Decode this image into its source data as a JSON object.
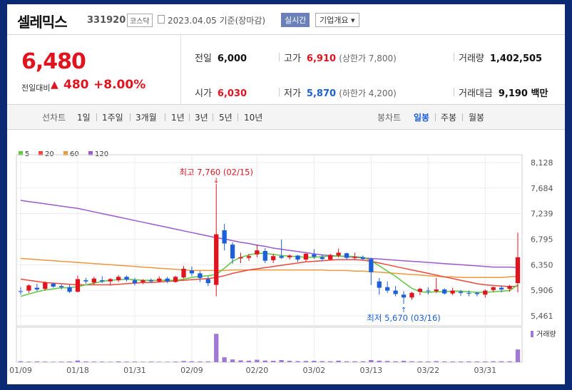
{
  "header": {
    "name": "셀레믹스",
    "code": "331920",
    "market": "코스닥",
    "date": "2023.04.05 기준(장마감)",
    "realtime_label": "실시간",
    "overview_label": "기업개요 ▾"
  },
  "price": {
    "current": "6,480",
    "change_label": "전일대비",
    "change_arrow": "▲",
    "change": "480",
    "change_pct": "+8.00%"
  },
  "stats": {
    "prev_close_label": "전일",
    "prev_close": "6,000",
    "high_label": "고가",
    "high": "6,910",
    "upper_limit": "(상한가 7,800)",
    "volume_label": "거래량",
    "volume": "1,402,505",
    "open_label": "시가",
    "open": "6,030",
    "low_label": "저가",
    "low": "5,870",
    "lower_limit": "(하한가 4,200)",
    "trade_value_label": "거래대금",
    "trade_value": "9,190 백만"
  },
  "tabs": {
    "line_header": "선차트",
    "line_items": [
      "1일",
      "1주일",
      "3개월",
      "1년",
      "3년",
      "5년",
      "10년"
    ],
    "candle_header": "봉차트",
    "candle_items": [
      "일봉",
      "주봉",
      "월봉"
    ],
    "candle_active": "일봉"
  },
  "chart_data": {
    "type": "candlestick",
    "legend": [
      {
        "name": "5",
        "color": "#5cc83c"
      },
      {
        "name": "20",
        "color": "#f0463c"
      },
      {
        "name": "60",
        "color": "#f0963c"
      },
      {
        "name": "120",
        "color": "#9b59d0"
      }
    ],
    "y_ticks": [
      "8,128",
      "7,684",
      "7,239",
      "6,795",
      "6,350",
      "5,906",
      "5,461"
    ],
    "ylim": [
      5461,
      8128
    ],
    "x_ticks": [
      "01/09",
      "01/18",
      "01/31",
      "02/09",
      "02/20",
      "03/02",
      "03/13",
      "03/22",
      "03/31"
    ],
    "x_tick_index": [
      0,
      7,
      14,
      21,
      29,
      36,
      43,
      50,
      57
    ],
    "annotations": {
      "high": "최고 7,760 (02/15)",
      "low": "최저 5,670 (03/16)"
    },
    "volume_label": "거래량",
    "candles": [
      [
        5890,
        5960,
        5830,
        5880
      ],
      [
        5900,
        6010,
        5860,
        5990
      ],
      [
        5950,
        6020,
        5890,
        5920
      ],
      [
        5930,
        6060,
        5900,
        6040
      ],
      [
        6020,
        6040,
        5950,
        5970
      ],
      [
        5980,
        6010,
        5920,
        5960
      ],
      [
        5960,
        6000,
        5860,
        5880
      ],
      [
        5880,
        6160,
        5870,
        6100
      ],
      [
        6080,
        6120,
        6020,
        6060
      ],
      [
        6040,
        6140,
        6000,
        6110
      ],
      [
        6080,
        6150,
        6030,
        6060
      ],
      [
        6060,
        6120,
        5990,
        6100
      ],
      [
        6080,
        6170,
        6050,
        6140
      ],
      [
        6140,
        6160,
        6060,
        6090
      ],
      [
        6080,
        6120,
        5990,
        6030
      ],
      [
        6050,
        6100,
        6010,
        6080
      ],
      [
        6080,
        6110,
        6030,
        6060
      ],
      [
        6060,
        6150,
        6040,
        6110
      ],
      [
        6110,
        6140,
        6030,
        6060
      ],
      [
        6050,
        6160,
        6040,
        6140
      ],
      [
        6130,
        6330,
        6110,
        6280
      ],
      [
        6250,
        6320,
        6150,
        6200
      ],
      [
        6200,
        6240,
        6050,
        6120
      ],
      [
        6100,
        6150,
        5980,
        6030
      ],
      [
        6000,
        7760,
        5800,
        6880
      ],
      [
        6950,
        7060,
        6600,
        6720
      ],
      [
        6700,
        6740,
        6370,
        6460
      ],
      [
        6460,
        6560,
        6380,
        6480
      ],
      [
        6470,
        6540,
        6420,
        6500
      ],
      [
        6530,
        6700,
        6480,
        6600
      ],
      [
        6590,
        6640,
        6380,
        6420
      ],
      [
        6430,
        6540,
        6380,
        6500
      ],
      [
        6500,
        6790,
        6450,
        6470
      ],
      [
        6480,
        6530,
        6440,
        6510
      ],
      [
        6510,
        6520,
        6400,
        6440
      ],
      [
        6440,
        6560,
        6410,
        6540
      ],
      [
        6530,
        6620,
        6450,
        6490
      ],
      [
        6480,
        6530,
        6410,
        6450
      ],
      [
        6440,
        6540,
        6430,
        6520
      ],
      [
        6510,
        6630,
        6480,
        6560
      ],
      [
        6550,
        6560,
        6440,
        6470
      ],
      [
        6470,
        6560,
        6440,
        6490
      ],
      [
        6480,
        6510,
        6430,
        6450
      ],
      [
        6450,
        6470,
        6000,
        6220
      ],
      [
        6060,
        6120,
        5830,
        5950
      ],
      [
        5960,
        6060,
        5860,
        5900
      ],
      [
        5900,
        5980,
        5800,
        5840
      ],
      [
        5830,
        5890,
        5670,
        5780
      ],
      [
        5780,
        5880,
        5740,
        5860
      ],
      [
        5880,
        5950,
        5820,
        5930
      ],
      [
        5900,
        5960,
        5830,
        5890
      ],
      [
        5890,
        6120,
        5860,
        5920
      ],
      [
        5920,
        5940,
        5830,
        5850
      ],
      [
        5850,
        5950,
        5820,
        5900
      ],
      [
        5880,
        5910,
        5810,
        5860
      ],
      [
        5860,
        5900,
        5800,
        5850
      ],
      [
        5860,
        5880,
        5800,
        5840
      ],
      [
        5830,
        5920,
        5780,
        5900
      ],
      [
        5910,
        5970,
        5880,
        5960
      ],
      [
        5950,
        5990,
        5870,
        5920
      ],
      [
        5930,
        6000,
        5880,
        5980
      ],
      [
        6030,
        6910,
        5870,
        6480
      ]
    ],
    "volumes": [
      0.6,
      0.4,
      0.5,
      0.4,
      0.3,
      0.4,
      0.5,
      1.1,
      0.5,
      0.4,
      0.4,
      0.3,
      0.5,
      0.4,
      0.4,
      0.3,
      0.4,
      0.3,
      0.3,
      0.4,
      0.8,
      0.6,
      0.5,
      0.5,
      18.5,
      3.2,
      1.8,
      1.2,
      1.0,
      1.6,
      1.1,
      0.9,
      1.4,
      0.9,
      0.7,
      0.8,
      0.9,
      0.7,
      0.6,
      1.0,
      0.6,
      0.6,
      0.6,
      1.4,
      1.0,
      0.8,
      0.6,
      0.9,
      0.6,
      0.5,
      0.5,
      0.7,
      0.5,
      0.5,
      0.5,
      0.5,
      0.5,
      0.5,
      0.6,
      0.6,
      0.6,
      8.3
    ],
    "ma5": [
      5800,
      5840,
      5880,
      5910,
      5930,
      5950,
      5950,
      5970,
      6000,
      6030,
      6060,
      6080,
      6090,
      6100,
      6090,
      6080,
      6080,
      6080,
      6080,
      6080,
      6100,
      6130,
      6150,
      6160,
      6180,
      6290,
      6410,
      6480,
      6520,
      6550,
      6550,
      6530,
      6510,
      6500,
      6490,
      6480,
      6480,
      6490,
      6500,
      6500,
      6500,
      6490,
      6480,
      6420,
      6330,
      6240,
      6150,
      6040,
      5940,
      5880,
      5870,
      5880,
      5880,
      5890,
      5890,
      5880,
      5870,
      5870,
      5880,
      5890,
      5900,
      6000
    ],
    "ma20": [
      6100,
      6080,
      6060,
      6040,
      6030,
      6020,
      6010,
      6000,
      6000,
      6000,
      6000,
      6000,
      6010,
      6020,
      6030,
      6040,
      6040,
      6050,
      6060,
      6070,
      6080,
      6090,
      6100,
      6110,
      6130,
      6160,
      6200,
      6230,
      6260,
      6280,
      6300,
      6320,
      6340,
      6360,
      6380,
      6400,
      6410,
      6420,
      6430,
      6440,
      6440,
      6440,
      6430,
      6410,
      6380,
      6350,
      6320,
      6290,
      6260,
      6230,
      6200,
      6170,
      6140,
      6110,
      6080,
      6050,
      6020,
      6000,
      5990,
      5980,
      5970,
      5980
    ],
    "ma60": [
      6460,
      6450,
      6440,
      6430,
      6420,
      6410,
      6400,
      6390,
      6380,
      6370,
      6360,
      6350,
      6340,
      6330,
      6320,
      6310,
      6300,
      6290,
      6280,
      6270,
      6260,
      6250,
      6250,
      6250,
      6250,
      6250,
      6260,
      6260,
      6260,
      6260,
      6260,
      6260,
      6260,
      6260,
      6260,
      6260,
      6260,
      6260,
      6250,
      6250,
      6250,
      6240,
      6240,
      6230,
      6220,
      6210,
      6200,
      6190,
      6180,
      6170,
      6160,
      6150,
      6140,
      6140,
      6130,
      6130,
      6130,
      6130,
      6130,
      6130,
      6140,
      6150
    ],
    "ma120": [
      7470,
      7450,
      7430,
      7410,
      7390,
      7370,
      7350,
      7330,
      7300,
      7270,
      7240,
      7210,
      7180,
      7150,
      7120,
      7090,
      7060,
      7030,
      7000,
      6970,
      6940,
      6910,
      6880,
      6850,
      6820,
      6800,
      6770,
      6740,
      6720,
      6690,
      6670,
      6640,
      6620,
      6600,
      6580,
      6560,
      6540,
      6520,
      6510,
      6500,
      6490,
      6480,
      6470,
      6460,
      6450,
      6440,
      6430,
      6420,
      6410,
      6400,
      6390,
      6380,
      6370,
      6360,
      6350,
      6340,
      6330,
      6320,
      6310,
      6310,
      6310,
      6300
    ]
  }
}
